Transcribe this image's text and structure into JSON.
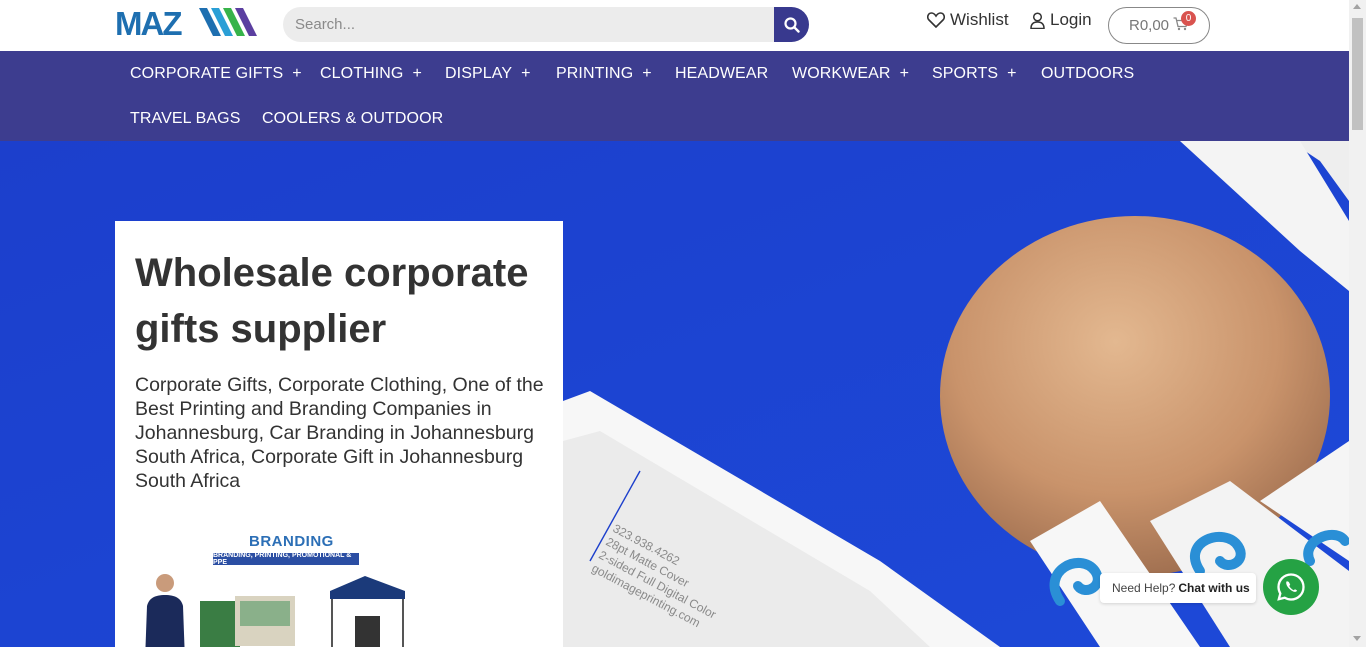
{
  "header": {
    "logo_text": "MAZ",
    "search_placeholder": "Search...",
    "wishlist_label": "Wishlist",
    "login_label": "Login",
    "cart_total": "R0,00",
    "cart_count": "0"
  },
  "nav": {
    "items": [
      {
        "label": "CORPORATE GIFTS",
        "has_submenu": true
      },
      {
        "label": "CLOTHING",
        "has_submenu": true
      },
      {
        "label": "DISPLAY",
        "has_submenu": true
      },
      {
        "label": "PRINTING",
        "has_submenu": true
      },
      {
        "label": "HEADWEAR",
        "has_submenu": false
      },
      {
        "label": "WORKWEAR",
        "has_submenu": true
      },
      {
        "label": "SPORTS",
        "has_submenu": true
      },
      {
        "label": "OUTDOORS",
        "has_submenu": false
      },
      {
        "label": "TRAVEL BAGS",
        "has_submenu": false
      },
      {
        "label": "COOLERS & OUTDOOR",
        "has_submenu": false
      }
    ],
    "plus_symbol": "+"
  },
  "hero": {
    "title": "Wholesale corporate gifts supplier",
    "description": "Corporate Gifts, Corporate Clothing, One of the Best Printing and Branding Companies in Johannesburg, Car Branding in Johannesburg South Africa, Corporate Gift in Johannesburg South Africa",
    "branding_title": "BRANDING",
    "branding_subtitle": "BRANDING, PRINTING, PROMOTIONAL & PPE",
    "card_text": [
      "323.938.4262",
      "28pt Matte Cover",
      "2-sided Full Digital Color",
      "goldimageprinting.com"
    ]
  },
  "chat": {
    "prefix": "Need Help?",
    "action": "Chat with us"
  },
  "colors": {
    "nav_bg": "#3d3d8f",
    "search_button": "#38398e",
    "hero_bg": "#1f45d1",
    "whatsapp": "#25a244",
    "badge": "#d9534f"
  },
  "icons": [
    "search-icon",
    "heart-icon",
    "user-icon",
    "cart-icon",
    "whatsapp-icon"
  ]
}
